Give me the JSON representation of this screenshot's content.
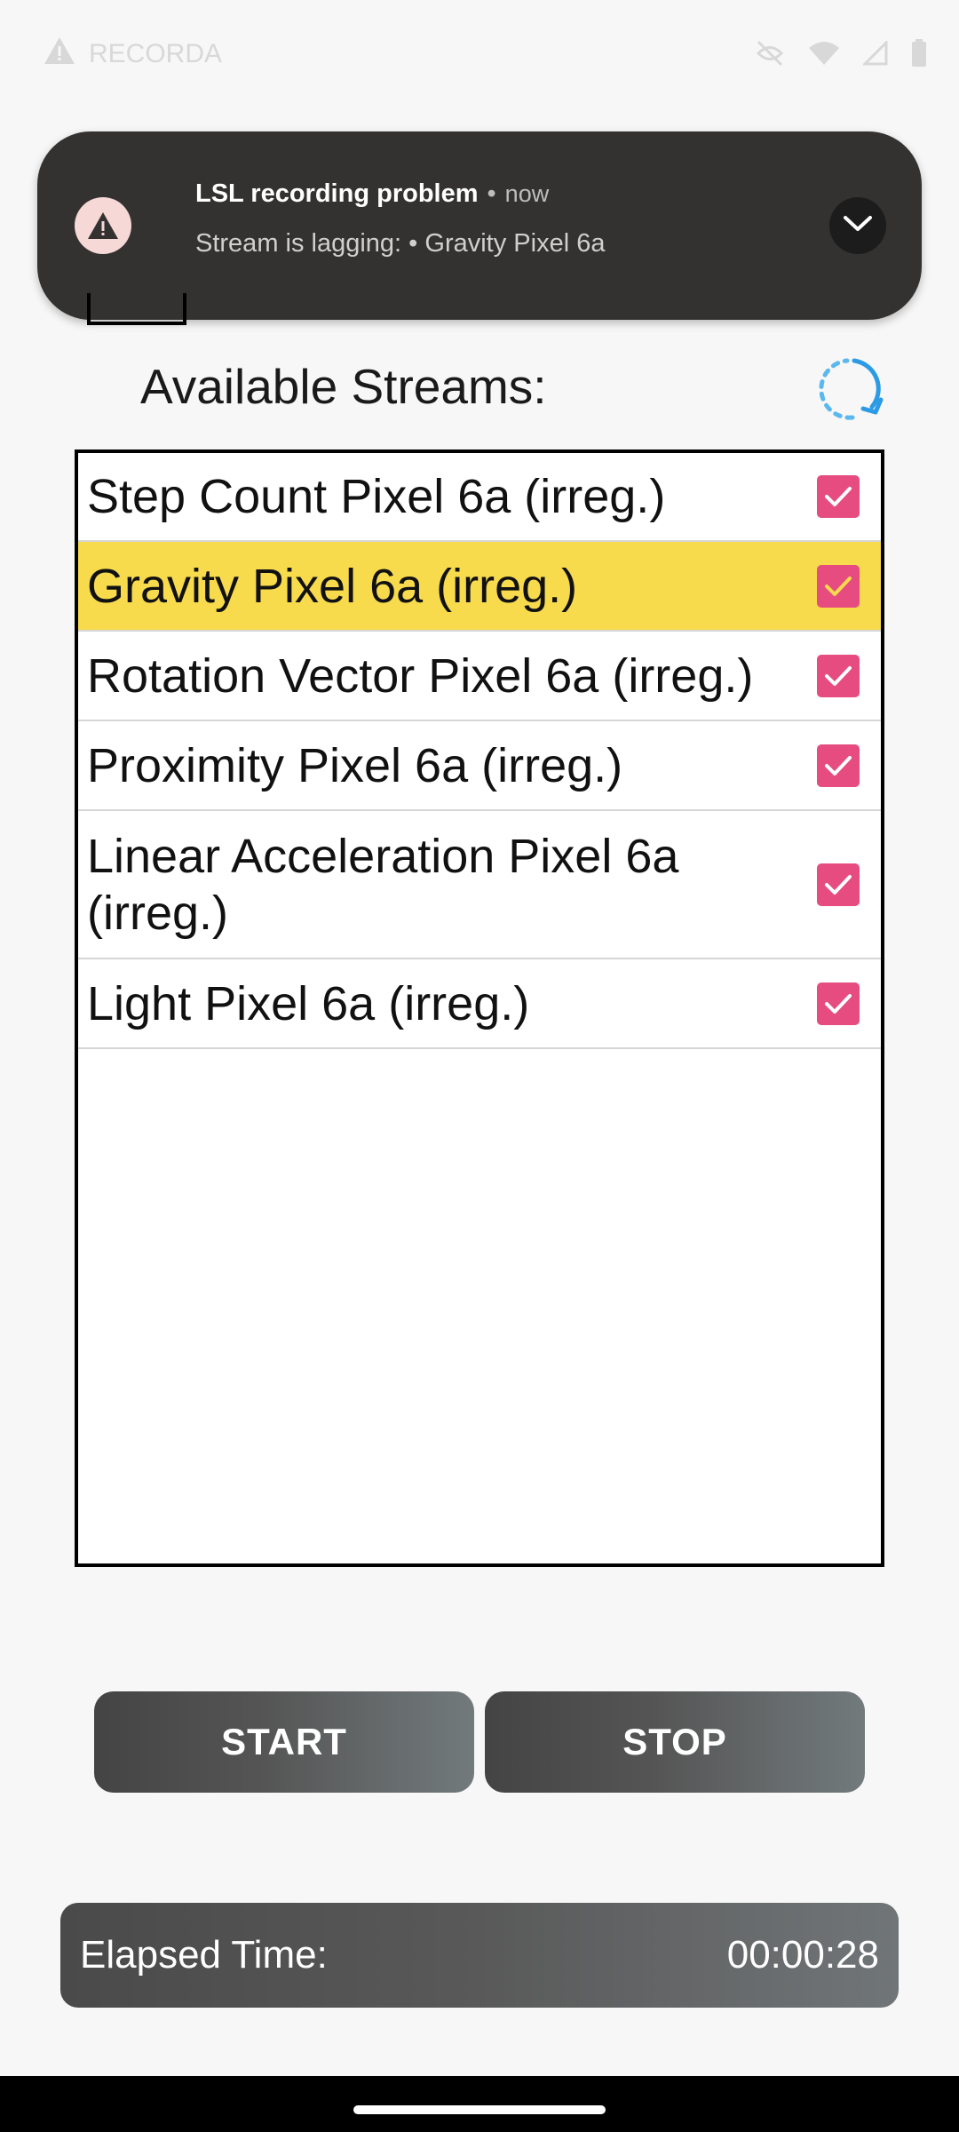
{
  "status_bar": {
    "app_label": "RECORDA",
    "icons": [
      "warning-icon",
      "mute-icon",
      "wifi-icon",
      "signal-icon",
      "battery-icon"
    ]
  },
  "notification": {
    "title": "LSL recording problem",
    "separator": "•",
    "time": "now",
    "body": "Stream is lagging: • Gravity Pixel 6a",
    "icon": "warning-icon",
    "expand_icon": "chevron-down-icon"
  },
  "streams_header": {
    "title": "Available Streams:",
    "refresh_icon": "refresh-icon"
  },
  "streams": [
    {
      "label": "Step Count Pixel 6a (irreg.)",
      "checked": true,
      "highlighted": false
    },
    {
      "label": "Gravity Pixel 6a (irreg.)",
      "checked": true,
      "highlighted": true
    },
    {
      "label": "Rotation Vector Pixel 6a (irreg.)",
      "checked": true,
      "highlighted": false
    },
    {
      "label": "Proximity Pixel 6a (irreg.)",
      "checked": true,
      "highlighted": false
    },
    {
      "label": "Linear Acceleration Pixel 6a (irreg.)",
      "checked": true,
      "highlighted": false
    },
    {
      "label": "Light Pixel 6a (irreg.)",
      "checked": true,
      "highlighted": false
    }
  ],
  "controls": {
    "start_label": "START",
    "stop_label": "STOP"
  },
  "elapsed": {
    "label": "Elapsed Time:",
    "value": "00:00:28"
  },
  "colors": {
    "highlight": "#f8db4c",
    "checkbox": "#e64c80",
    "notification_bg": "#333231"
  }
}
